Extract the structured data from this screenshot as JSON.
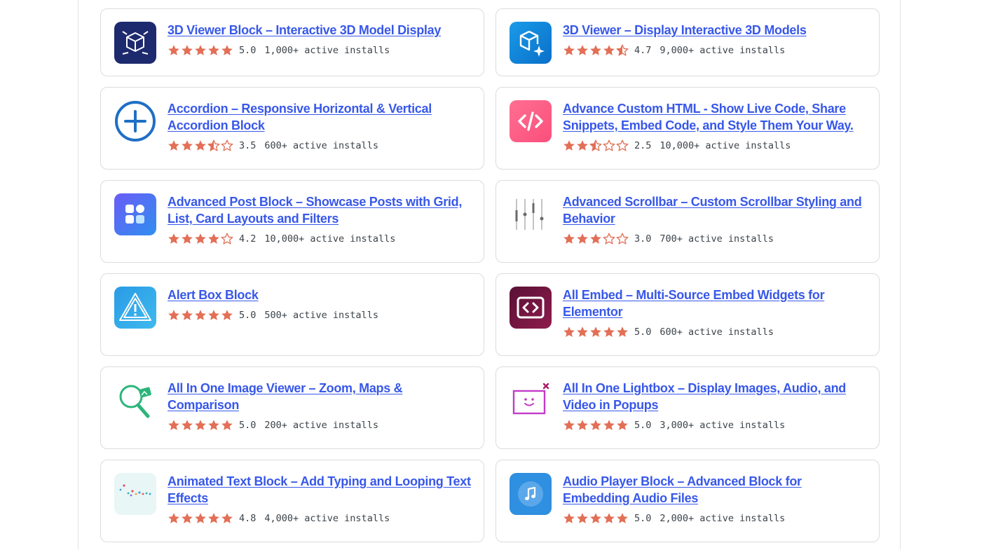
{
  "star_color": "#e26f56",
  "installs_suffix": "active installs",
  "plugins": [
    {
      "id": "p1",
      "title": "3D Viewer Block – Interactive 3D Model Display",
      "rating": "5.0",
      "stars": 5,
      "installs": "1,000+ active installs",
      "icon": "3d-cube-icon"
    },
    {
      "id": "p2",
      "title": "3D Viewer – Display Interactive 3D Models",
      "rating": "4.7",
      "stars": 4.5,
      "installs": "9,000+ active installs",
      "icon": "cube-sparkle-icon"
    },
    {
      "id": "p3",
      "title": "Accordion – Responsive Horizontal & Vertical Accordion Block",
      "rating": "3.5",
      "stars": 3.5,
      "installs": "600+ active installs",
      "icon": "plus-circle-icon"
    },
    {
      "id": "p4",
      "title": "Advance Custom HTML - Show Live Code, Share Snippets, Embed Code, and Style Them Your Way.",
      "rating": "2.5",
      "stars": 2.5,
      "installs": "10,000+ active installs",
      "icon": "code-icon"
    },
    {
      "id": "p5",
      "title": "Advanced Post Block – Showcase Posts with Grid, List, Card Layouts and Filters",
      "rating": "4.2",
      "stars": 4,
      "installs": "10,000+ active installs",
      "icon": "grid-blocks-icon"
    },
    {
      "id": "p6",
      "title": "Advanced Scrollbar – Custom Scrollbar Styling and Behavior",
      "rating": "3.0",
      "stars": 3,
      "installs": "700+ active installs",
      "icon": "scrollbar-sliders-icon"
    },
    {
      "id": "p7",
      "title": "Alert Box Block",
      "rating": "5.0",
      "stars": 5,
      "installs": "500+ active installs",
      "icon": "alert-triangle-icon"
    },
    {
      "id": "p8",
      "title": "All Embed – Multi-Source Embed Widgets for Elementor",
      "rating": "5.0",
      "stars": 5,
      "installs": "600+ active installs",
      "icon": "embed-code-icon"
    },
    {
      "id": "p9",
      "title": "All In One Image Viewer – Zoom, Maps & Comparison",
      "rating": "5.0",
      "stars": 5,
      "installs": "200+ active installs",
      "icon": "magnifier-image-icon"
    },
    {
      "id": "p10",
      "title": "All In One Lightbox – Display Images, Audio, and Video in Popups",
      "rating": "5.0",
      "stars": 5,
      "installs": "3,000+ active installs",
      "icon": "lightbox-smile-icon"
    },
    {
      "id": "p11",
      "title": "Animated Text Block – Add Typing and Looping Text Effects",
      "rating": "4.8",
      "stars": 5,
      "installs": "4,000+ active installs",
      "icon": "animated-dots-icon"
    },
    {
      "id": "p12",
      "title": "Audio Player Block – Advanced Block for Embedding Audio Files",
      "rating": "5.0",
      "stars": 5,
      "installs": "2,000+ active installs",
      "icon": "music-note-icon"
    }
  ]
}
